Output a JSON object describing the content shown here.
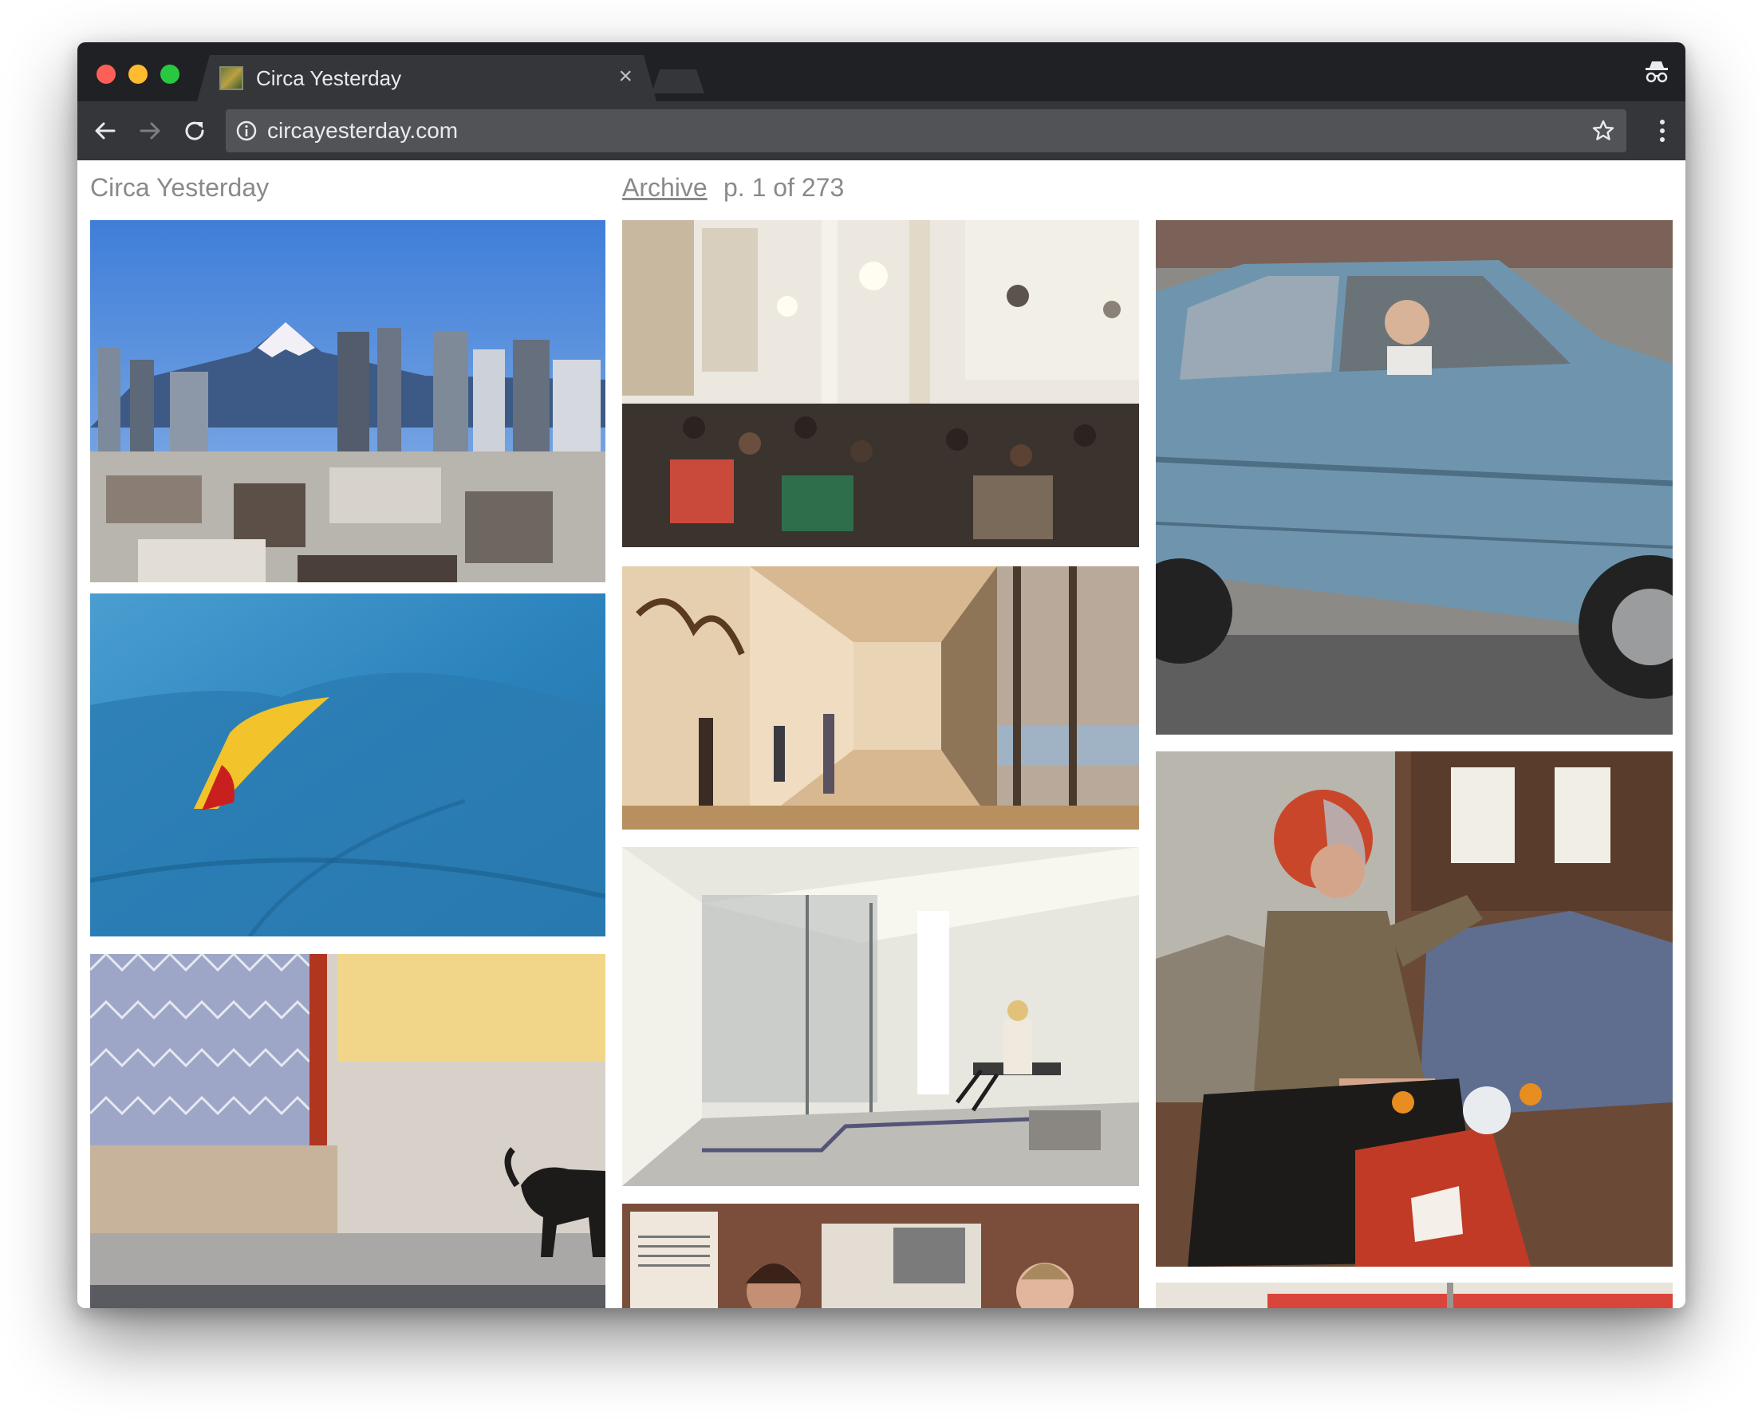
{
  "browser": {
    "tab_title": "Circa Yesterday",
    "tab_close": "×",
    "url": "circayesterday.com",
    "icons": [
      "back-arrow-icon",
      "forward-arrow-icon",
      "reload-icon",
      "info-icon",
      "star-icon",
      "menu-icon",
      "incognito-icon",
      "close-icon"
    ],
    "colors": {
      "frame": "#202124",
      "toolbar": "#35363a",
      "omnibox": "#525357",
      "text": "#e8eaed"
    }
  },
  "page": {
    "site_title": "Circa Yesterday",
    "archive_link": "Archive",
    "page_count": "p. 1 of 273",
    "text_color": "#8a8a8a"
  },
  "photos": [
    {
      "subject": "tokyo-skyline-mount-fuji"
    },
    {
      "subject": "blue-tarp-yellow"
    },
    {
      "subject": "tiled-wall-black-dog"
    },
    {
      "subject": "school-hall-audience"
    },
    {
      "subject": "gallery-corridor-sculpture"
    },
    {
      "subject": "glass-office-lobby"
    },
    {
      "subject": "children-reading-newspaper"
    },
    {
      "subject": "blue-car-driver"
    },
    {
      "subject": "man-on-moped"
    },
    {
      "subject": "red-car-partial"
    }
  ]
}
